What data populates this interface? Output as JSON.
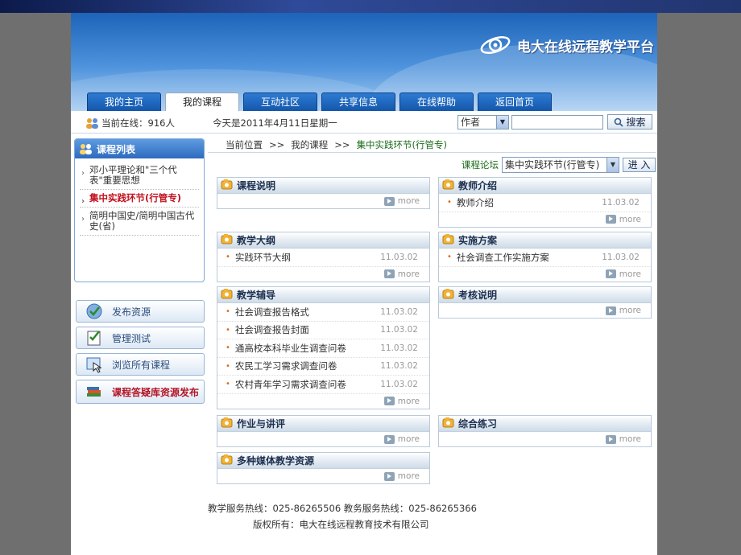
{
  "site": {
    "title": "电大在线远程教学平台"
  },
  "nav": [
    "我的主页",
    "我的课程",
    "互动社区",
    "共享信息",
    "在线帮助",
    "返回首页"
  ],
  "info": {
    "online": "当前在线：916人",
    "date": "今天是2011年4月11日星期一",
    "search_field": "作者",
    "search_value": "",
    "search_button": "搜索"
  },
  "sidebar": {
    "title": "课程列表",
    "courses": [
      "邓小平理论和\"三个代表\"重要思想",
      "集中实践环节(行管专)",
      "简明中国史/简明中国古代史(省)"
    ],
    "active_course": "集中实践环节(行管专)",
    "actions": [
      "发布资源",
      "管理测试",
      "浏览所有课程",
      "课程答疑库资源发布"
    ]
  },
  "breadcrumb": [
    "当前位置",
    ">>",
    "我的课程",
    ">>",
    "集中实践环节(行管专)"
  ],
  "forum": {
    "label": "课程论坛",
    "selected": "集中实践环节(行管专)",
    "button": "进 入"
  },
  "more_label": "more",
  "boxes": {
    "course_desc": {
      "title": "课程说明",
      "items": []
    },
    "teacher": {
      "title": "教师介绍",
      "items": [
        {
          "text": "教师介绍",
          "date": "11.03.02"
        }
      ]
    },
    "syllabus": {
      "title": "教学大纲",
      "items": [
        {
          "text": "实践环节大纲",
          "date": "11.03.02"
        }
      ]
    },
    "plan": {
      "title": "实施方案",
      "items": [
        {
          "text": "社会调查工作实施方案",
          "date": "11.03.02"
        }
      ]
    },
    "tutoring": {
      "title": "教学辅导",
      "items": [
        {
          "text": "社会调查报告格式",
          "date": "11.03.02"
        },
        {
          "text": "社会调查报告封面",
          "date": "11.03.02"
        },
        {
          "text": "通高校本科毕业生调查问卷",
          "date": "11.03.02"
        },
        {
          "text": "农民工学习需求调查问卷",
          "date": "11.03.02"
        },
        {
          "text": "农村青年学习需求调查问卷",
          "date": "11.03.02"
        }
      ]
    },
    "exam": {
      "title": "考核说明",
      "items": []
    },
    "homework": {
      "title": "作业与讲评",
      "items": []
    },
    "practice": {
      "title": "综合练习",
      "items": []
    },
    "media": {
      "title": "多种媒体教学资源",
      "items": []
    }
  },
  "footer": {
    "line1": "教学服务热线：025-86265506 教务服务热线：025-86265366",
    "line2": "版权所有：电大在线远程教育技术有限公司"
  },
  "colors": {
    "brand_blue": "#1d64b9",
    "accent_red": "#c1121f",
    "crumb_green": "#1a6b1a"
  }
}
